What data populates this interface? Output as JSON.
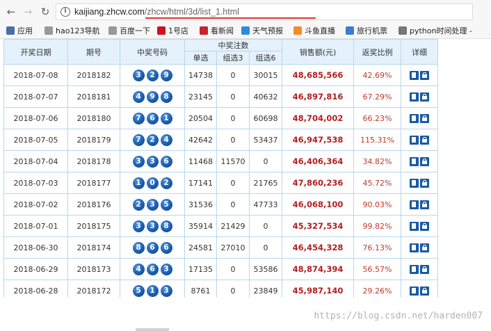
{
  "browser": {
    "url_host": "kaijiang.zhcw.com",
    "url_path": "/zhcw/html/3d/list_1.html",
    "bookmarks": [
      {
        "label": "应用",
        "icon": "apps-grid-icon",
        "color": "#4a6fa5"
      },
      {
        "label": "hao123导航",
        "icon": "page-icon",
        "color": "#999999"
      },
      {
        "label": "百度一下",
        "icon": "page-icon",
        "color": "#999999"
      },
      {
        "label": "1号店",
        "icon": "store-logo-icon",
        "color": "#d0101c"
      },
      {
        "label": "看新闻",
        "icon": "news-logo-icon",
        "color": "#c8222a"
      },
      {
        "label": "天气预报",
        "icon": "weather-icon",
        "color": "#2d8ed6"
      },
      {
        "label": "斗鱼直播",
        "icon": "douyu-icon",
        "color": "#f28c28"
      },
      {
        "label": "旅行机票",
        "icon": "plane-icon",
        "color": "#3a7bd5"
      },
      {
        "label": "python时间处理 -",
        "icon": "page-icon",
        "color": "#777777"
      }
    ]
  },
  "table": {
    "headers": {
      "date": "开奖日期",
      "issue": "期号",
      "numbers": "中奖号码",
      "bets": "中奖注数",
      "single": "单选",
      "group3": "组选3",
      "group6": "组选6",
      "sales": "销售额(元)",
      "ratio": "返奖比例",
      "detail": "详细"
    },
    "rows": [
      {
        "date": "2018-07-08",
        "issue": "2018182",
        "n1": "3",
        "n2": "2",
        "n3": "9",
        "single": "14738",
        "group3": "0",
        "group6": "30015",
        "sales": "48,685,566",
        "ratio": "42.69%"
      },
      {
        "date": "2018-07-07",
        "issue": "2018181",
        "n1": "4",
        "n2": "9",
        "n3": "8",
        "single": "23145",
        "group3": "0",
        "group6": "40632",
        "sales": "46,897,816",
        "ratio": "67.29%"
      },
      {
        "date": "2018-07-06",
        "issue": "2018180",
        "n1": "7",
        "n2": "6",
        "n3": "1",
        "single": "20504",
        "group3": "0",
        "group6": "60698",
        "sales": "48,704,002",
        "ratio": "66.23%"
      },
      {
        "date": "2018-07-05",
        "issue": "2018179",
        "n1": "7",
        "n2": "2",
        "n3": "4",
        "single": "42642",
        "group3": "0",
        "group6": "53437",
        "sales": "46,947,538",
        "ratio": "115.31%"
      },
      {
        "date": "2018-07-04",
        "issue": "2018178",
        "n1": "3",
        "n2": "3",
        "n3": "6",
        "single": "11468",
        "group3": "11570",
        "group6": "0",
        "sales": "46,406,364",
        "ratio": "34.82%"
      },
      {
        "date": "2018-07-03",
        "issue": "2018177",
        "n1": "1",
        "n2": "0",
        "n3": "2",
        "single": "17141",
        "group3": "0",
        "group6": "21765",
        "sales": "47,860,236",
        "ratio": "45.72%"
      },
      {
        "date": "2018-07-02",
        "issue": "2018176",
        "n1": "2",
        "n2": "3",
        "n3": "5",
        "single": "31536",
        "group3": "0",
        "group6": "47733",
        "sales": "46,068,100",
        "ratio": "90.03%"
      },
      {
        "date": "2018-07-01",
        "issue": "2018175",
        "n1": "3",
        "n2": "3",
        "n3": "8",
        "single": "35914",
        "group3": "21429",
        "group6": "0",
        "sales": "45,327,534",
        "ratio": "99.82%"
      },
      {
        "date": "2018-06-30",
        "issue": "2018174",
        "n1": "8",
        "n2": "6",
        "n3": "6",
        "single": "24581",
        "group3": "27010",
        "group6": "0",
        "sales": "46,454,328",
        "ratio": "76.13%"
      },
      {
        "date": "2018-06-29",
        "issue": "2018173",
        "n1": "4",
        "n2": "6",
        "n3": "3",
        "single": "17135",
        "group3": "0",
        "group6": "53586",
        "sales": "48,874,394",
        "ratio": "56.57%"
      },
      {
        "date": "2018-06-28",
        "issue": "2018172",
        "n1": "5",
        "n2": "1",
        "n3": "3",
        "single": "8761",
        "group3": "0",
        "group6": "23849",
        "sales": "45,987,140",
        "ratio": "29.26%"
      }
    ]
  },
  "watermark": "https://blog.csdn.net/harden007",
  "colors": {
    "header_bg": "#e5f1fc",
    "border": "#b8d7ee",
    "ball": "#1b5fb1",
    "sales": "#b02020",
    "ratio": "#c0392b"
  }
}
